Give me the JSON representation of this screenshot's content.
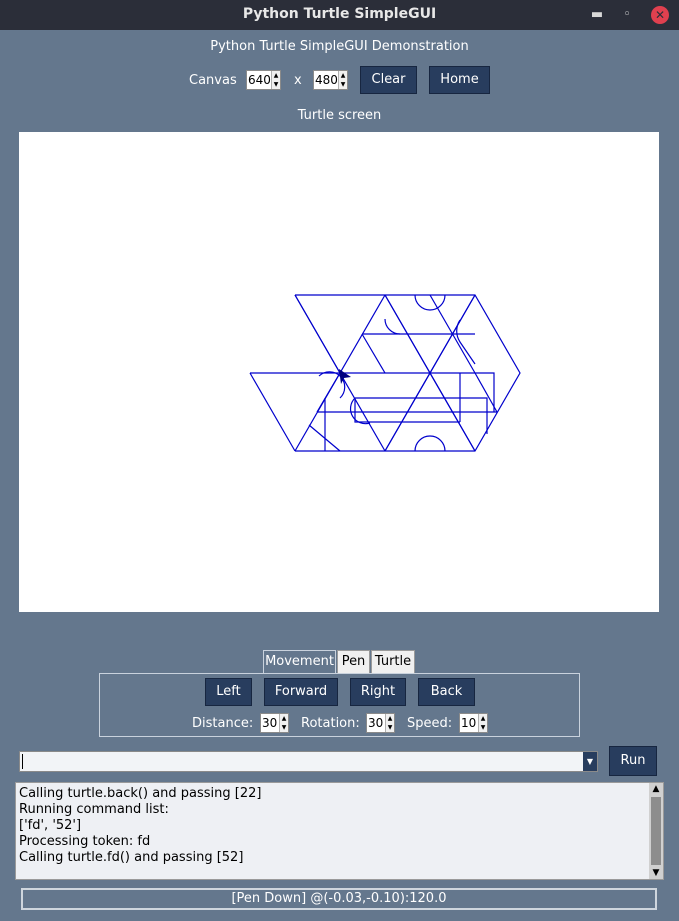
{
  "window": {
    "title": "Python Turtle SimpleGUI",
    "minimize_icon": "minimize-icon",
    "restore_icon": "restore-icon",
    "close_icon": "close-icon"
  },
  "header": {
    "title": "Python Turtle SimpleGUI Demonstration"
  },
  "canvas_controls": {
    "label": "Canvas",
    "width_value": "640",
    "separator": "x",
    "height_value": "480",
    "clear_label": "Clear",
    "home_label": "Home"
  },
  "screen": {
    "label": "Turtle screen",
    "pen_color": "#0000cc",
    "turtle_color": "#000080"
  },
  "tabs": [
    {
      "label": "Movement",
      "active": true
    },
    {
      "label": "Pen",
      "active": false
    },
    {
      "label": "Turtle",
      "active": false
    }
  ],
  "movement": {
    "left_label": "Left",
    "forward_label": "Forward",
    "right_label": "Right",
    "back_label": "Back",
    "distance_label": "Distance:",
    "distance_value": "30",
    "rotation_label": "Rotation:",
    "rotation_value": "30",
    "speed_label": "Speed:",
    "speed_value": "10"
  },
  "command": {
    "value": "",
    "run_label": "Run"
  },
  "output": {
    "lines": [
      "Calling turtle.back() and passing [22]",
      "Running command list:",
      "['fd', '52']",
      "Processing token: fd",
      "Calling turtle.fd() and passing [52]"
    ]
  },
  "status": {
    "text": "[Pen Down] @(-0.03,-0.10):120.0"
  },
  "colors": {
    "window_bg": "#64778d",
    "button_bg": "#283d5e",
    "titlebar_bg": "#2b2e39"
  }
}
